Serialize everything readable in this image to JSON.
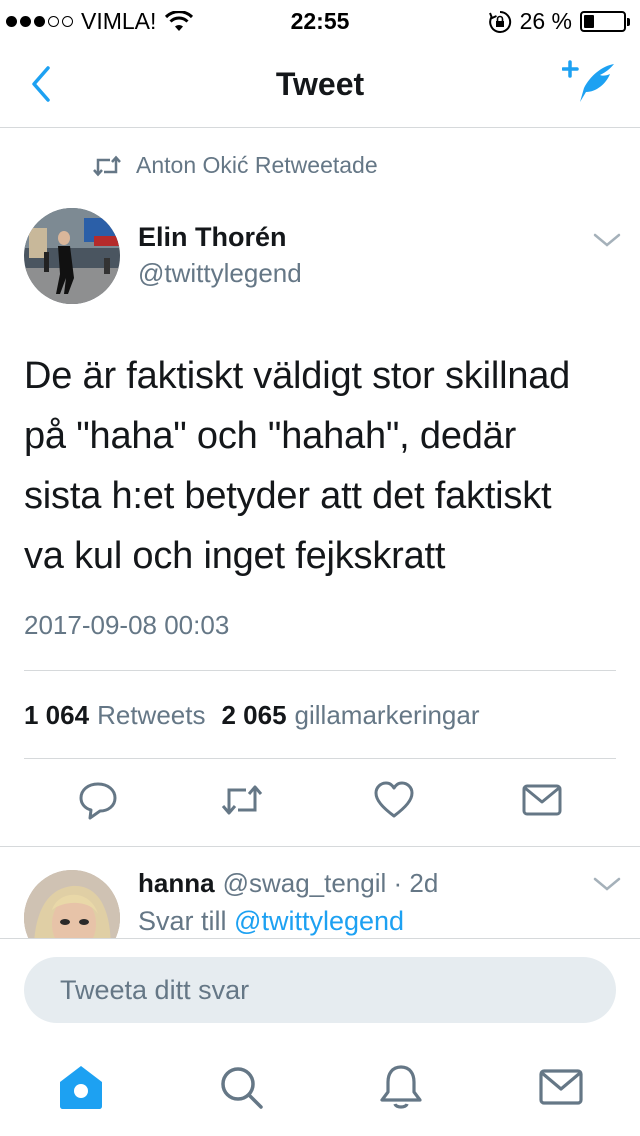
{
  "status_bar": {
    "carrier": "VIMLA!",
    "time": "22:55",
    "battery_percent_text": "26 %",
    "battery_level": 0.26
  },
  "nav": {
    "title": "Tweet"
  },
  "retweet": {
    "text": "Anton Okić Retweetade"
  },
  "tweet": {
    "author_name": "Elin Thorén",
    "author_handle": "@twittylegend",
    "lines": [
      "De är faktiskt väldigt stor skillnad",
      "på \"haha\" och \"hahah\", dedär",
      "sista h:et betyder att det faktiskt",
      "va kul och inget fejkskratt"
    ],
    "timestamp": "2017-09-08 00:03"
  },
  "stats": {
    "retweets_count": "1 064",
    "retweets_label": "Retweets",
    "likes_count": "2 065",
    "likes_label": "gillamarkeringar"
  },
  "reply": {
    "name": "hanna",
    "handle_time": "@swag_tengil · 2d",
    "reply_prefix": "Svar till",
    "reply_link": "@twittylegend"
  },
  "composer": {
    "placeholder": "Tweeta ditt svar"
  },
  "colors": {
    "accent": "#1da1f2",
    "secondary_text": "#657786",
    "icon_gray": "#657786"
  }
}
